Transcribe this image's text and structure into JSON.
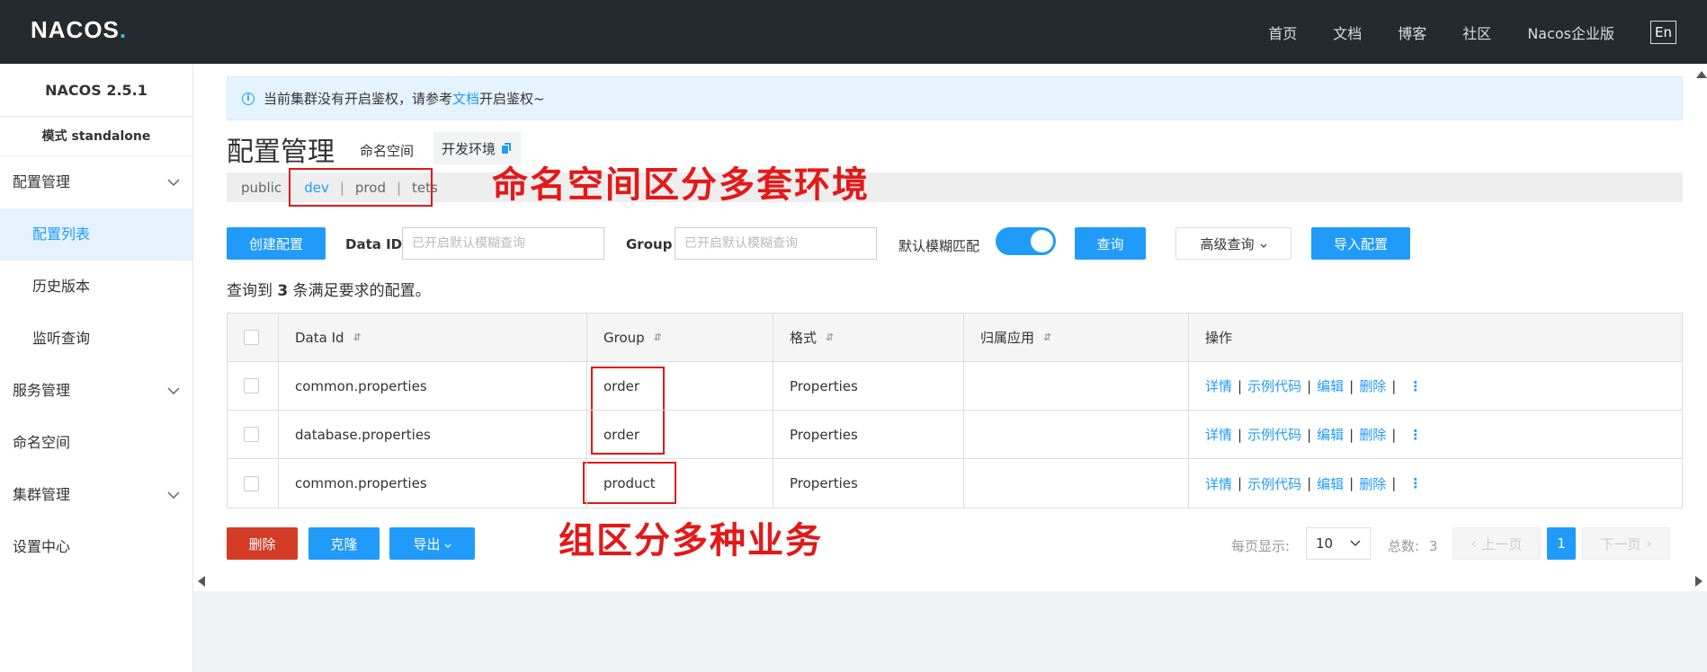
{
  "brand": {
    "logo_main": "NACOS",
    "logo_dot": "."
  },
  "topnav": {
    "items": [
      "首页",
      "文档",
      "博客",
      "社区",
      "Nacos企业版"
    ],
    "lang": "En"
  },
  "sidebar": {
    "version": "NACOS 2.5.1",
    "mode": "模式 standalone",
    "items": [
      {
        "label": "配置管理"
      },
      {
        "label": "配置列表"
      },
      {
        "label": "历史版本"
      },
      {
        "label": "监听查询"
      },
      {
        "label": "服务管理"
      },
      {
        "label": "命名空间"
      },
      {
        "label": "集群管理"
      },
      {
        "label": "设置中心"
      }
    ]
  },
  "notice": {
    "before": "当前集群没有开启鉴权，请参考",
    "link": "文档",
    "after": "开启鉴权~"
  },
  "header": {
    "title": "配置管理",
    "namespace_label": "命名空间",
    "namespace_current": "开发环境"
  },
  "namespaces": [
    "public",
    "dev",
    "prod",
    "tets"
  ],
  "separator": "|",
  "annotations": {
    "namespace": "命名空间区分多套环境",
    "group": "组区分多种业务"
  },
  "search": {
    "create_button": "创建配置",
    "dataid_label": "Data ID",
    "dataid_placeholder": "已开启默认模糊查询",
    "group_label": "Group",
    "group_placeholder": "已开启默认模糊查询",
    "fuzzy_label": "默认模糊匹配",
    "fuzzy_on": true,
    "query_button": "查询",
    "advanced_button": "高级查询",
    "import_button": "导入配置"
  },
  "result": {
    "prefix": "查询到",
    "count": "3",
    "suffix": "条满足要求的配置。"
  },
  "table": {
    "columns": [
      "Data Id",
      "Group",
      "格式",
      "归属应用",
      "操作"
    ],
    "sort_glyph": "⇵",
    "rows": [
      {
        "data_id": "common.properties",
        "group": "order",
        "format": "Properties",
        "app": ""
      },
      {
        "data_id": "database.properties",
        "group": "order",
        "format": "Properties",
        "app": ""
      },
      {
        "data_id": "common.properties",
        "group": "product",
        "format": "Properties",
        "app": ""
      }
    ],
    "ops": [
      "详情",
      "示例代码",
      "编辑",
      "删除"
    ],
    "more": "⋮"
  },
  "footer": {
    "delete_button": "删除",
    "clone_button": "克隆",
    "export_button": "导出",
    "page_size_label": "每页显示:",
    "page_size": "10",
    "total_label": "总数:",
    "total": "3",
    "prev": "上一页",
    "current_page": "1",
    "next": "下一页"
  },
  "colors": {
    "accent": "#209bfa",
    "annotation": "#e41818",
    "danger": "#d23c26",
    "nav_bg": "#252a2f"
  }
}
